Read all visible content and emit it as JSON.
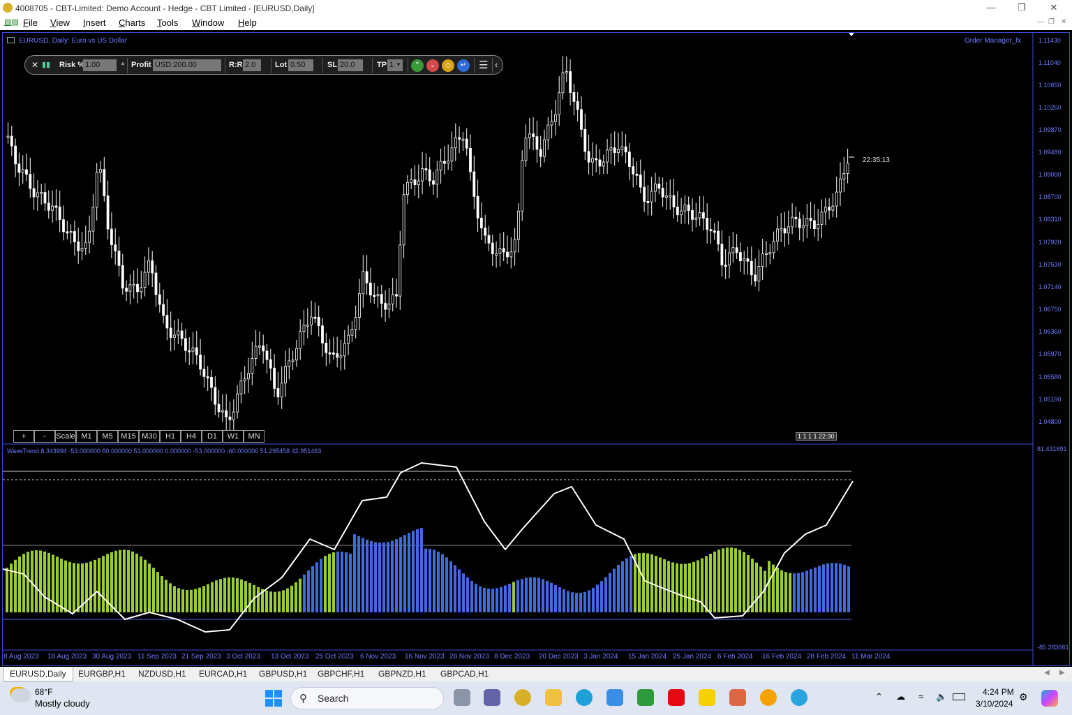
{
  "window": {
    "title": "4008705 - CBT-Limited: Demo Account - Hedge - CBT Limited - [EURUSD,Daily]"
  },
  "menu": {
    "items": [
      "File",
      "View",
      "Insert",
      "Charts",
      "Tools",
      "Window",
      "Help"
    ]
  },
  "chart": {
    "symbol_caption": "EURUSD, Daily:  Euro vs US Dollar",
    "order_manager": "Order Manager_fx",
    "countdown": "22:35:13",
    "mini_timer": "1 1 1 1 22:30",
    "price_axis": [
      "1.11430",
      "1.11040",
      "1.10650",
      "1.10260",
      "1.09870",
      "1.09480",
      "1.09090",
      "1.08700",
      "1.08310",
      "1.07920",
      "1.07530",
      "1.07140",
      "1.06750",
      "1.06360",
      "1.05970",
      "1.05580",
      "1.05190",
      "1.04800"
    ],
    "date_axis": [
      "8 Aug 2023",
      "18 Aug 2023",
      "30 Aug 2023",
      "11 Sep 2023",
      "21 Sep 2023",
      "3 Oct 2023",
      "13 Oct 2023",
      "25 Oct 2023",
      "6 Nov 2023",
      "16 Nov 2023",
      "28 Nov 2023",
      "8 Dec 2023",
      "20 Dec 2023",
      "3 Jan 2024",
      "15 Jan 2024",
      "25 Jan 2024",
      "6 Feb 2024",
      "16 Feb 2024",
      "28 Feb 2024",
      "11 Mar 2024"
    ],
    "colors": {
      "axis": "#6f7cff",
      "candle": "#ffffff",
      "hist_up": "#9acd32",
      "hist_down": "#4169e1",
      "wave": "#ffffff"
    }
  },
  "trade_toolbar": {
    "risk_label": "Risk %",
    "risk_value": "1.00",
    "profit_label": "Profit",
    "profit_value": "USD:200.00",
    "rr_label": "R:R",
    "rr_value": "2.0",
    "lot_label": "Lot",
    "lot_value": "0.50",
    "sl_label": "SL",
    "sl_value": "20.0",
    "tp_label": "TP",
    "tp_value": "1"
  },
  "timeframes": [
    "+",
    "-",
    "Scale",
    "M1",
    "M5",
    "M15",
    "M30",
    "H1",
    "H4",
    "D1",
    "W1",
    "MN"
  ],
  "indicator": {
    "label": "WaveTrend 8.343994 -53.000000 60.000000 53.000000 0.000000 -53.000000 -60.000000 51.295458 42.951463",
    "axis_max": "81.431691",
    "axis_min": "-85.283661"
  },
  "tabs": [
    "EURUSD,Daily",
    "EURGBP,H1",
    "NZDUSD,H1",
    "EURCAD,H1",
    "GBPUSD,H1",
    "GBPCHF,H1",
    "GBPNZD,H1",
    "GBPCAD,H1"
  ],
  "taskbar": {
    "weather_temp": "68°F",
    "weather_desc": "Mostly cloudy",
    "search": "Search",
    "time": "4:24 PM",
    "date": "3/10/2024"
  }
}
